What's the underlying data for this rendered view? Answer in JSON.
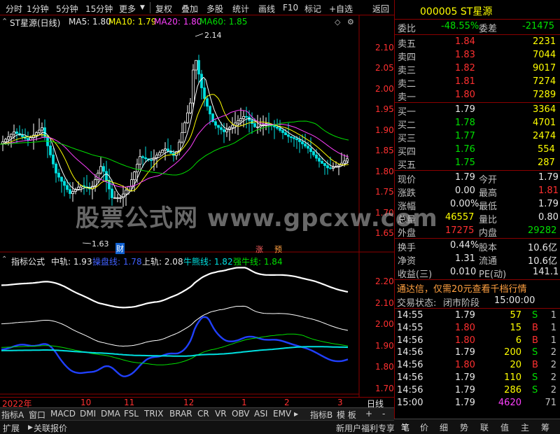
{
  "toolbar": {
    "items": [
      "分时",
      "1分钟",
      "5分钟",
      "15分钟",
      "更多",
      "复权",
      "叠加",
      "多股",
      "统计",
      "画线",
      "F10",
      "标记",
      "+自选",
      "返回"
    ]
  },
  "main_chart": {
    "title": "ST星源(日线)",
    "ma5_label": "MA5: 1.80",
    "ma10_label": "MA10: 1.79",
    "ma20_label": "MA20: 1.80",
    "ma60_label": "MA60: 1.85",
    "high_marker": "2.14",
    "low_marker": "1.63",
    "price_ticks": [
      "2.10",
      "2.05",
      "2.00",
      "1.95",
      "1.90",
      "1.85",
      "1.80",
      "1.75",
      "1.70",
      "1.65"
    ],
    "marker_cai": "财",
    "marker_zhang": "涨",
    "marker_yu": "预",
    "colors": {
      "ma5": "#ffffff",
      "ma10": "#ffff00",
      "ma20": "#ff40ff",
      "ma60": "#00e000",
      "up": "#ff3030",
      "down": "#00e0e0"
    }
  },
  "watermark": "股票公式网 www.gpcxw.com",
  "indicator": {
    "name": "指标公式",
    "mid_label": "中轨: 1.93",
    "ctrl_label": "操盘线: 1.78",
    "upper_label": "上轨: 2.08",
    "bull_label": "牛熊线: 1.82",
    "strong_label": "强牛线: 1.84",
    "ticks": [
      "2.20",
      "2.10",
      "2.00",
      "1.90",
      "1.80",
      "1.70"
    ]
  },
  "date_axis": {
    "labels": [
      "2022年",
      "10",
      "11",
      "12",
      "1",
      "2",
      "3"
    ],
    "period": "日线"
  },
  "tabs": [
    "指标A",
    "窗口",
    "MACD",
    "DMI",
    "DMA",
    "FSL",
    "TRIX",
    "BRAR",
    "CR",
    "VR",
    "OBV",
    "ASI",
    "EMV",
    "指标B",
    "模 板",
    "+",
    "-"
  ],
  "status": {
    "left": "扩展",
    "right": "关联报价",
    "promo": "新用户福利专享"
  },
  "quote": {
    "code_name": "000005 ST星源",
    "webi_label": "委比",
    "webi": "-48.55%",
    "weicha_label": "委差",
    "weicha": "-21475",
    "asks": [
      {
        "label": "卖五",
        "price": "1.84",
        "vol": "2231"
      },
      {
        "label": "卖四",
        "price": "1.83",
        "vol": "7044"
      },
      {
        "label": "卖三",
        "price": "1.82",
        "vol": "9017"
      },
      {
        "label": "卖二",
        "price": "1.81",
        "vol": "7274"
      },
      {
        "label": "卖一",
        "price": "1.80",
        "vol": "7289"
      }
    ],
    "bids": [
      {
        "label": "买一",
        "price": "1.79",
        "vol": "3364"
      },
      {
        "label": "买二",
        "price": "1.78",
        "vol": "4701"
      },
      {
        "label": "买三",
        "price": "1.77",
        "vol": "2474"
      },
      {
        "label": "买四",
        "price": "1.76",
        "vol": "554"
      },
      {
        "label": "买五",
        "price": "1.75",
        "vol": "287"
      }
    ],
    "stats": [
      {
        "l1": "现价",
        "v1": "1.79",
        "l2": "今开",
        "v2": "1.79"
      },
      {
        "l1": "涨跌",
        "v1": "0.00",
        "l2": "最高",
        "v2": "1.81"
      },
      {
        "l1": "涨幅",
        "v1": "0.00%",
        "l2": "最低",
        "v2": "1.79"
      },
      {
        "l1": "总量",
        "v1": "46557",
        "l2": "量比",
        "v2": "0.80"
      },
      {
        "l1": "外盘",
        "v1": "17275",
        "l2": "内盘",
        "v2": "29282"
      }
    ],
    "stats2": [
      {
        "l1": "换手",
        "v1": "0.44%",
        "l2": "股本",
        "v2": "10.6亿"
      },
      {
        "l1": "净资",
        "v1": "1.31",
        "l2": "流通",
        "v2": "10.6亿"
      },
      {
        "l1": "收益(三)",
        "v1": "0.010",
        "l2": "PE(动)",
        "v2": "141.1"
      }
    ],
    "promo": "通达信，仅需20元查看千档行情",
    "trade_state_label": "交易状态:",
    "trade_state": "闭市阶段",
    "trade_time": "15:00:00",
    "ticks": [
      {
        "t": "14:55",
        "p": "1.79",
        "v": "57",
        "s": "S",
        "n": "1"
      },
      {
        "t": "14:55",
        "p": "1.80",
        "v": "15",
        "s": "B",
        "n": "1"
      },
      {
        "t": "14:56",
        "p": "1.80",
        "v": "6",
        "s": "B",
        "n": "1"
      },
      {
        "t": "14:56",
        "p": "1.79",
        "v": "200",
        "s": "S",
        "n": "2"
      },
      {
        "t": "14:56",
        "p": "1.80",
        "v": "20",
        "s": "B",
        "n": "2"
      },
      {
        "t": "14:56",
        "p": "1.79",
        "v": "110",
        "s": "S",
        "n": "2"
      },
      {
        "t": "14:56",
        "p": "1.79",
        "v": "286",
        "s": "S",
        "n": "2"
      },
      {
        "t": "15:00",
        "p": "1.79",
        "v": "4620",
        "s": "",
        "n": "71"
      }
    ],
    "bottom_tabs": [
      "笔",
      "价",
      "细",
      "势",
      "联",
      "值",
      "主",
      "筹"
    ]
  }
}
